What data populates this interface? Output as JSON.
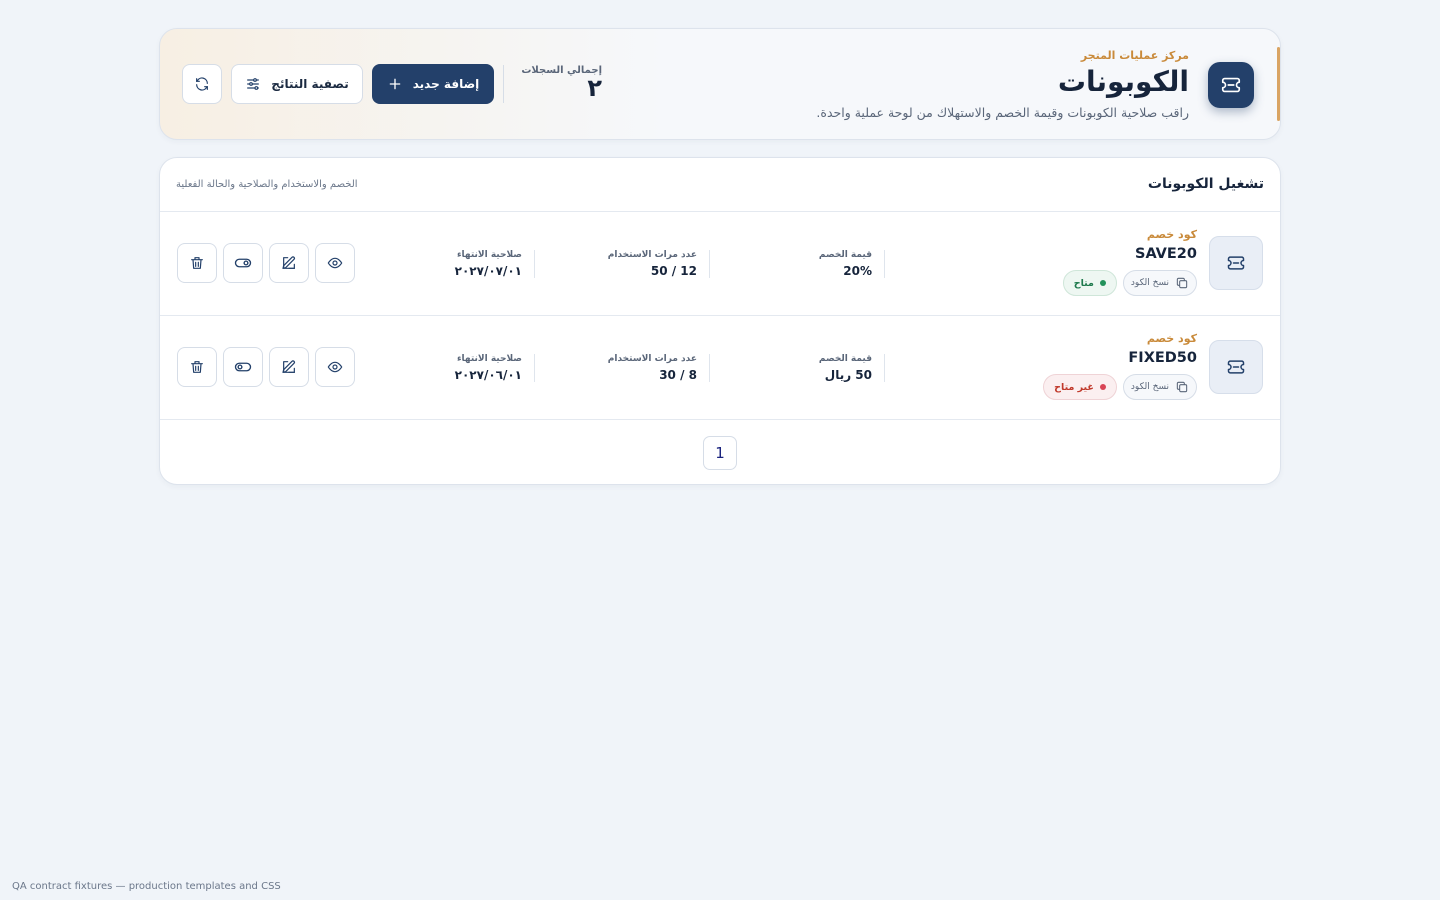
{
  "header": {
    "kicker": "مركز عمليات المتجر",
    "title": "الكوبونات",
    "description": "راقب صلاحية الكوبونات وقيمة الخصم والاستهلاك من لوحة عملية واحدة.",
    "total_label": "إجمالي السجلات",
    "total_value": "٢",
    "add_label": "إضافة جديد",
    "filter_label": "تصفية النتائج",
    "icon": "ticket-icon"
  },
  "panel": {
    "title": "تشغيل الكوبونات",
    "subtitle": "الخصم والاستخدام والصلاحية والحالة الفعلية"
  },
  "coupons": [
    {
      "kicker": "كود خصم",
      "code": "SAVE20",
      "copy_label": "نسخ الكود",
      "status": "متاح",
      "discount_label": "قيمة الخصم",
      "discount_value": "20%",
      "usage_label": "عدد مرات الاستخدام",
      "usage_value": "12 / 50",
      "expiry_label": "صلاحية الانتهاء",
      "expiry_value": "٢٠٢٧/٠٧/٠١"
    },
    {
      "kicker": "كود خصم",
      "code": "FIXED50",
      "copy_label": "نسخ الكود",
      "status": "غير متاح",
      "discount_label": "قيمة الخصم",
      "discount_value": "50 ريال",
      "usage_label": "عدد مرات الاستخدام",
      "usage_value": "8 / 30",
      "expiry_label": "صلاحية الانتهاء",
      "expiry_value": "٢٠٢٧/٠٦/٠١"
    }
  ],
  "pagination": {
    "current": "1"
  },
  "footer": "QA contract fixtures — production templates and CSS",
  "colors": {
    "primary": "#23406a",
    "accent": "#c98a3a",
    "success": "#1f7a4d",
    "danger": "#c0392b"
  }
}
